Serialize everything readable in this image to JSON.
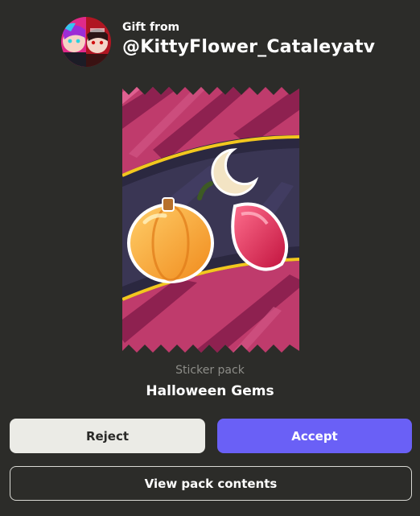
{
  "gift": {
    "from_label": "Gift from",
    "username": "@KittyFlower_Cataleyatv"
  },
  "pack": {
    "type_label": "Sticker pack",
    "name": "Halloween Gems"
  },
  "actions": {
    "reject_label": "Reject",
    "accept_label": "Accept",
    "view_label": "View pack contents"
  },
  "colors": {
    "background": "#2c2c29",
    "accent": "#6a60f6",
    "reject_bg": "#ebebe6",
    "pack_pink": "#c0416e"
  }
}
